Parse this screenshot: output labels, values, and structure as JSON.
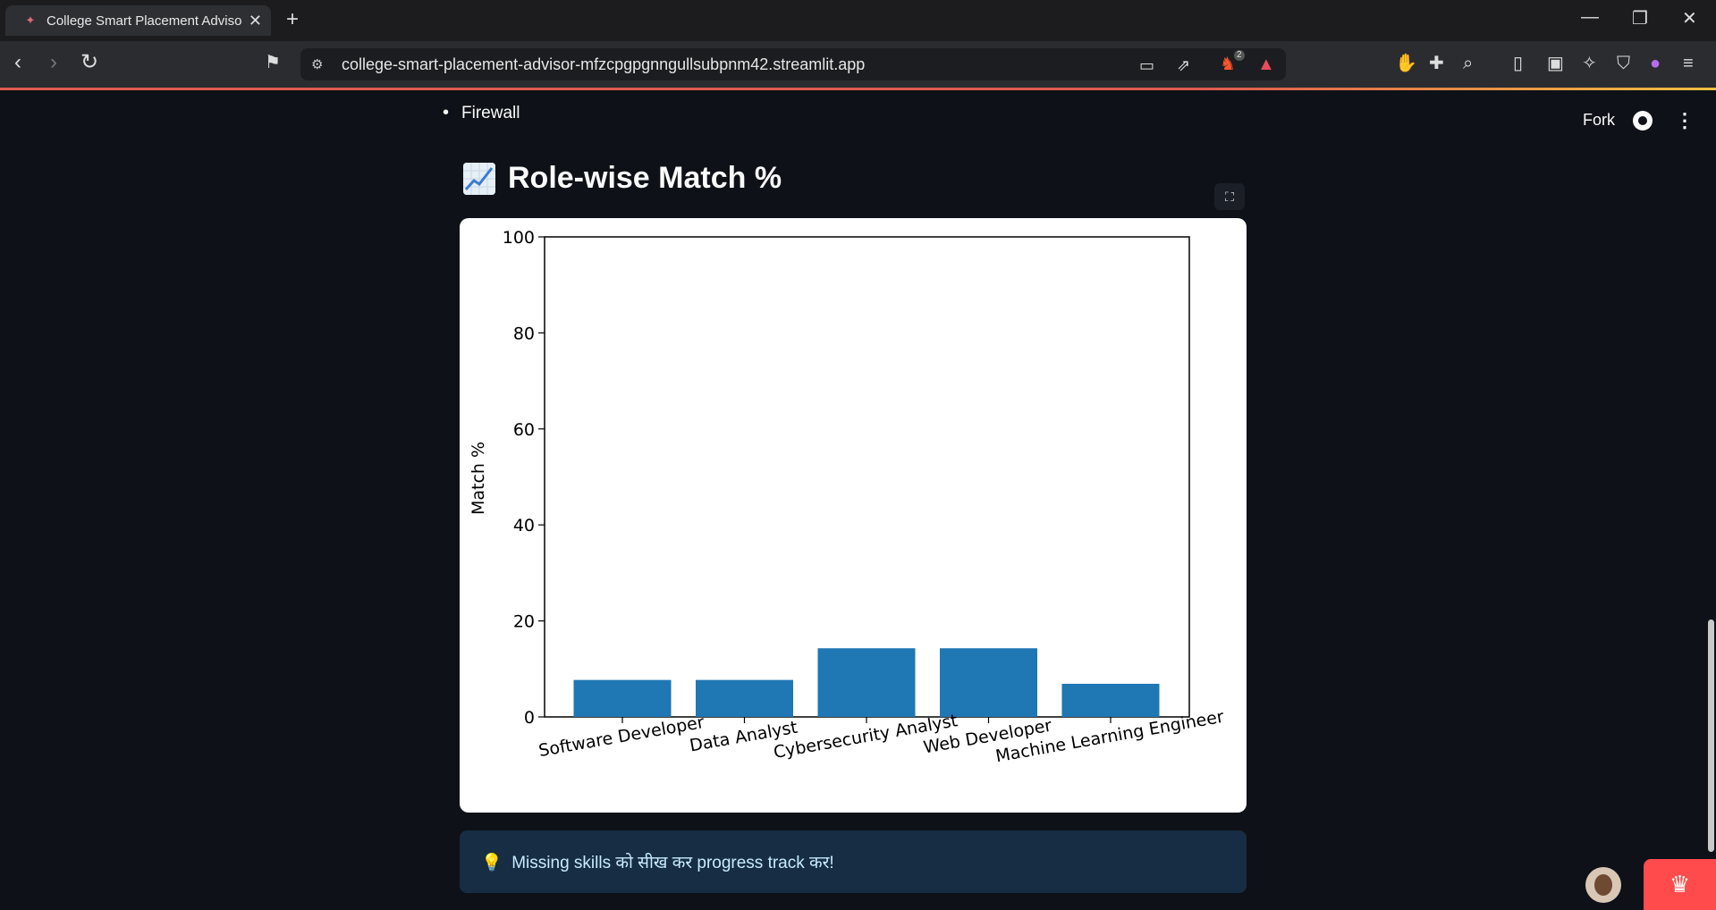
{
  "browser": {
    "tab_title": "College Smart Placement Adviso",
    "url": "college-smart-placement-advisor-mfzcpgpgnngullsubpnm42.streamlit.app",
    "brave_badge": "2"
  },
  "toolbar": {
    "fork_label": "Fork"
  },
  "content": {
    "bullet_item": "Firewall",
    "section_title": "Role-wise Match %",
    "info_text": "Missing skills को सीख कर progress track कर!"
  },
  "chart_data": {
    "type": "bar",
    "categories": [
      "Software Developer",
      "Data Analyst",
      "Cybersecurity Analyst",
      "Web Developer",
      "Machine Learning Engineer"
    ],
    "values": [
      7.7,
      7.7,
      14.3,
      14.3,
      6.9
    ],
    "ylabel": "Match %",
    "xlabel": "",
    "ylim": [
      0,
      100
    ],
    "yticks": [
      0,
      20,
      40,
      60,
      80,
      100
    ],
    "bar_color": "#1f77b4"
  }
}
